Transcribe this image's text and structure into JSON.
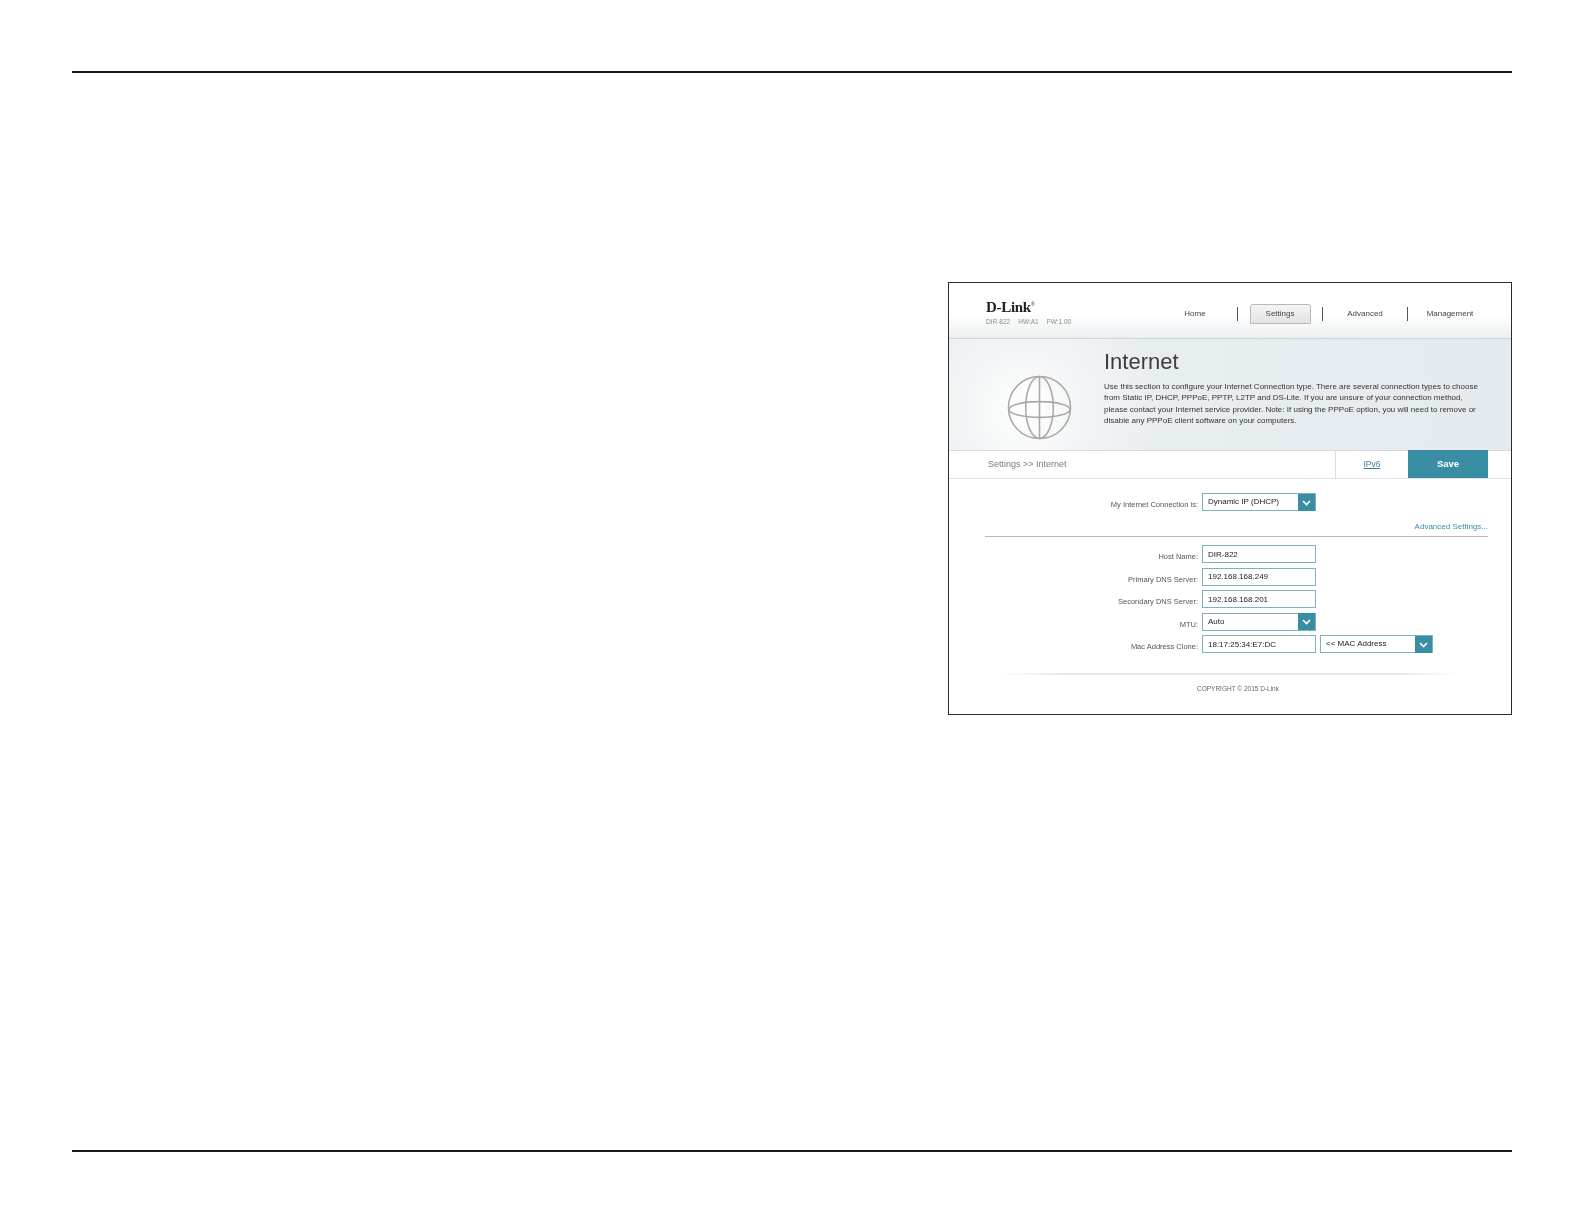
{
  "screenshot": {
    "header": {
      "logo": "D-Link$^{®}$",
      "model": "DIR-822",
      "hardware": "HW:A1",
      "firmware": "FW:1.00",
      "nav": [
        {
          "label": "Home",
          "selected": false
        },
        {
          "label": "Settings",
          "selected": true
        },
        {
          "label": "Advanced",
          "selected": false
        },
        {
          "label": "Management",
          "selected": false
        }
      ]
    },
    "banner": {
      "title": "Internet",
      "description": "Use this section to configure your Internet Connection type. There are several connection types to choose from Static IP, DHCP, PPPoE, PPTP, L2TP and DS-Lite. If you are unsure of your connection method, please contact your Internet service provider. Note: If using the PPPoE option, you will need to remove or disable any PPPoE client software on your computers."
    },
    "toolbar": {
      "breadcrumb": "Settings >> Internet",
      "link": "IPv6",
      "save": "Save"
    },
    "connection": {
      "label": "My Internet Connection is:",
      "value": "Dynamic IP (DHCP)"
    },
    "advanced_link": "Advanced Settings...",
    "fields": [
      {
        "kind": "text",
        "label": "Host Name:",
        "value": "DIR-822"
      },
      {
        "kind": "text",
        "label": "Primary DNS Server:",
        "value": "192.168.168.249"
      },
      {
        "kind": "text",
        "label": "Secondary DNS Server:",
        "value": "192.168.168.201"
      },
      {
        "kind": "select",
        "label": "MTU:",
        "value": "Auto"
      },
      {
        "kind": "text_select",
        "label": "Mac Address Clone:",
        "value": "18:17:25:34:E7:DC",
        "option": "<< MAC Address"
      }
    ],
    "footer": "COPYRIGHT © 2015 D-Link"
  }
}
